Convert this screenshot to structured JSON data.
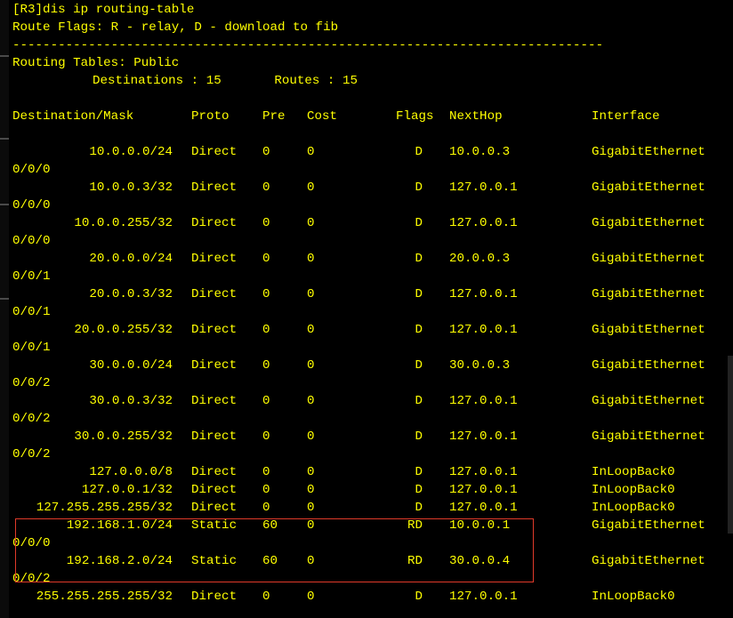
{
  "command": "[R3]dis ip routing-table",
  "flags_legend": "Route Flags: R - relay, D - download to fib",
  "separator": "------------------------------------------------------------------------------",
  "table_name": "Routing Tables: Public",
  "counts": "Destinations : 15       Routes : 15",
  "headers": {
    "destination": "Destination/Mask",
    "proto": "Proto",
    "pre": "Pre",
    "cost": "Cost",
    "flags": "Flags",
    "nexthop": "NextHop",
    "interface": "Interface"
  },
  "routes": [
    {
      "dest": "10.0.0.0/24",
      "proto": "Direct",
      "pre": "0",
      "cost": "0",
      "flags": "D",
      "nexthop": "10.0.0.3",
      "iface": "GigabitEthernet",
      "iface_cont": "0/0/0"
    },
    {
      "dest": "10.0.0.3/32",
      "proto": "Direct",
      "pre": "0",
      "cost": "0",
      "flags": "D",
      "nexthop": "127.0.0.1",
      "iface": "GigabitEthernet",
      "iface_cont": "0/0/0"
    },
    {
      "dest": "10.0.0.255/32",
      "proto": "Direct",
      "pre": "0",
      "cost": "0",
      "flags": "D",
      "nexthop": "127.0.0.1",
      "iface": "GigabitEthernet",
      "iface_cont": "0/0/0"
    },
    {
      "dest": "20.0.0.0/24",
      "proto": "Direct",
      "pre": "0",
      "cost": "0",
      "flags": "D",
      "nexthop": "20.0.0.3",
      "iface": "GigabitEthernet",
      "iface_cont": "0/0/1"
    },
    {
      "dest": "20.0.0.3/32",
      "proto": "Direct",
      "pre": "0",
      "cost": "0",
      "flags": "D",
      "nexthop": "127.0.0.1",
      "iface": "GigabitEthernet",
      "iface_cont": "0/0/1"
    },
    {
      "dest": "20.0.0.255/32",
      "proto": "Direct",
      "pre": "0",
      "cost": "0",
      "flags": "D",
      "nexthop": "127.0.0.1",
      "iface": "GigabitEthernet",
      "iface_cont": "0/0/1"
    },
    {
      "dest": "30.0.0.0/24",
      "proto": "Direct",
      "pre": "0",
      "cost": "0",
      "flags": "D",
      "nexthop": "30.0.0.3",
      "iface": "GigabitEthernet",
      "iface_cont": "0/0/2"
    },
    {
      "dest": "30.0.0.3/32",
      "proto": "Direct",
      "pre": "0",
      "cost": "0",
      "flags": "D",
      "nexthop": "127.0.0.1",
      "iface": "GigabitEthernet",
      "iface_cont": "0/0/2"
    },
    {
      "dest": "30.0.0.255/32",
      "proto": "Direct",
      "pre": "0",
      "cost": "0",
      "flags": "D",
      "nexthop": "127.0.0.1",
      "iface": "GigabitEthernet",
      "iface_cont": "0/0/2"
    },
    {
      "dest": "127.0.0.0/8",
      "proto": "Direct",
      "pre": "0",
      "cost": "0",
      "flags": "D",
      "nexthop": "127.0.0.1",
      "iface": "InLoopBack0",
      "iface_cont": ""
    },
    {
      "dest": "127.0.0.1/32",
      "proto": "Direct",
      "pre": "0",
      "cost": "0",
      "flags": "D",
      "nexthop": "127.0.0.1",
      "iface": "InLoopBack0",
      "iface_cont": ""
    },
    {
      "dest": "127.255.255.255/32",
      "proto": "Direct",
      "pre": "0",
      "cost": "0",
      "flags": "D",
      "nexthop": "127.0.0.1",
      "iface": "InLoopBack0",
      "iface_cont": ""
    },
    {
      "dest": "192.168.1.0/24",
      "proto": "Static",
      "pre": "60",
      "cost": "0",
      "flags": "RD",
      "nexthop": "10.0.0.1",
      "iface": "GigabitEthernet",
      "iface_cont": "0/0/0"
    },
    {
      "dest": "192.168.2.0/24",
      "proto": "Static",
      "pre": "60",
      "cost": "0",
      "flags": "RD",
      "nexthop": "30.0.0.4",
      "iface": "GigabitEthernet",
      "iface_cont": "0/0/2"
    },
    {
      "dest": "255.255.255.255/32",
      "proto": "Direct",
      "pre": "0",
      "cost": "0",
      "flags": "D",
      "nexthop": "127.0.0.1",
      "iface": "InLoopBack0",
      "iface_cont": ""
    }
  ],
  "colors": {
    "background": "#000000",
    "text": "#ffff00",
    "highlight_border": "#e03a2a"
  }
}
